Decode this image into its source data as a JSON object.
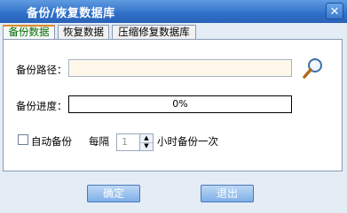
{
  "window": {
    "title": "备份/恢复数据库",
    "close_glyph": "✕"
  },
  "tabs": [
    {
      "label": "备份数据",
      "active": true
    },
    {
      "label": "恢复数据",
      "active": false
    },
    {
      "label": "压缩修复数据库",
      "active": false
    }
  ],
  "form": {
    "path_label": "备份路径：",
    "path_value": "",
    "progress_label": "备份进度：",
    "progress_text": "0%",
    "progress_value": 0,
    "auto_backup_label": "自动备份",
    "auto_backup_checked": false,
    "interval_prefix": "每隔",
    "interval_value": "1",
    "interval_suffix": "小时备份一次"
  },
  "buttons": {
    "ok": "确定",
    "exit": "退出"
  },
  "icons": {
    "browse": "search-icon"
  },
  "colors": {
    "title_bar": "#2f6fc8",
    "active_tab_text": "#006a00",
    "button": "#7fb0e8"
  }
}
